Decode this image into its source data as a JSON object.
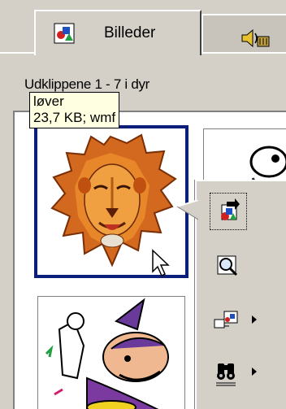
{
  "tabs": [
    {
      "label": "Billeder",
      "icon": "pictures-icon",
      "active": true
    },
    {
      "label": "",
      "icon": "sound-icon",
      "active": false
    }
  ],
  "caption": "Udklippene 1 - 7 i dyr",
  "tooltip": {
    "name": "løver",
    "details": "23,7 KB; wmf"
  },
  "thumbnails": [
    {
      "name": "lion-clip",
      "selected": true
    },
    {
      "name": "creature-clip",
      "selected": false
    },
    {
      "name": "wizard-clip",
      "selected": false
    },
    {
      "name": "partial-clip",
      "selected": false
    }
  ],
  "popup_buttons": [
    {
      "icon": "insert-clip-icon",
      "has_submenu": false,
      "focused": true
    },
    {
      "icon": "preview-clip-icon",
      "has_submenu": false,
      "focused": false
    },
    {
      "icon": "add-to-category-icon",
      "has_submenu": true,
      "focused": false
    },
    {
      "icon": "find-similar-icon",
      "has_submenu": true,
      "focused": false
    }
  ],
  "colors": {
    "selection_border": "#0a1e7a",
    "tooltip_bg": "#ffffe1",
    "window_bg": "#d4d0c8"
  }
}
